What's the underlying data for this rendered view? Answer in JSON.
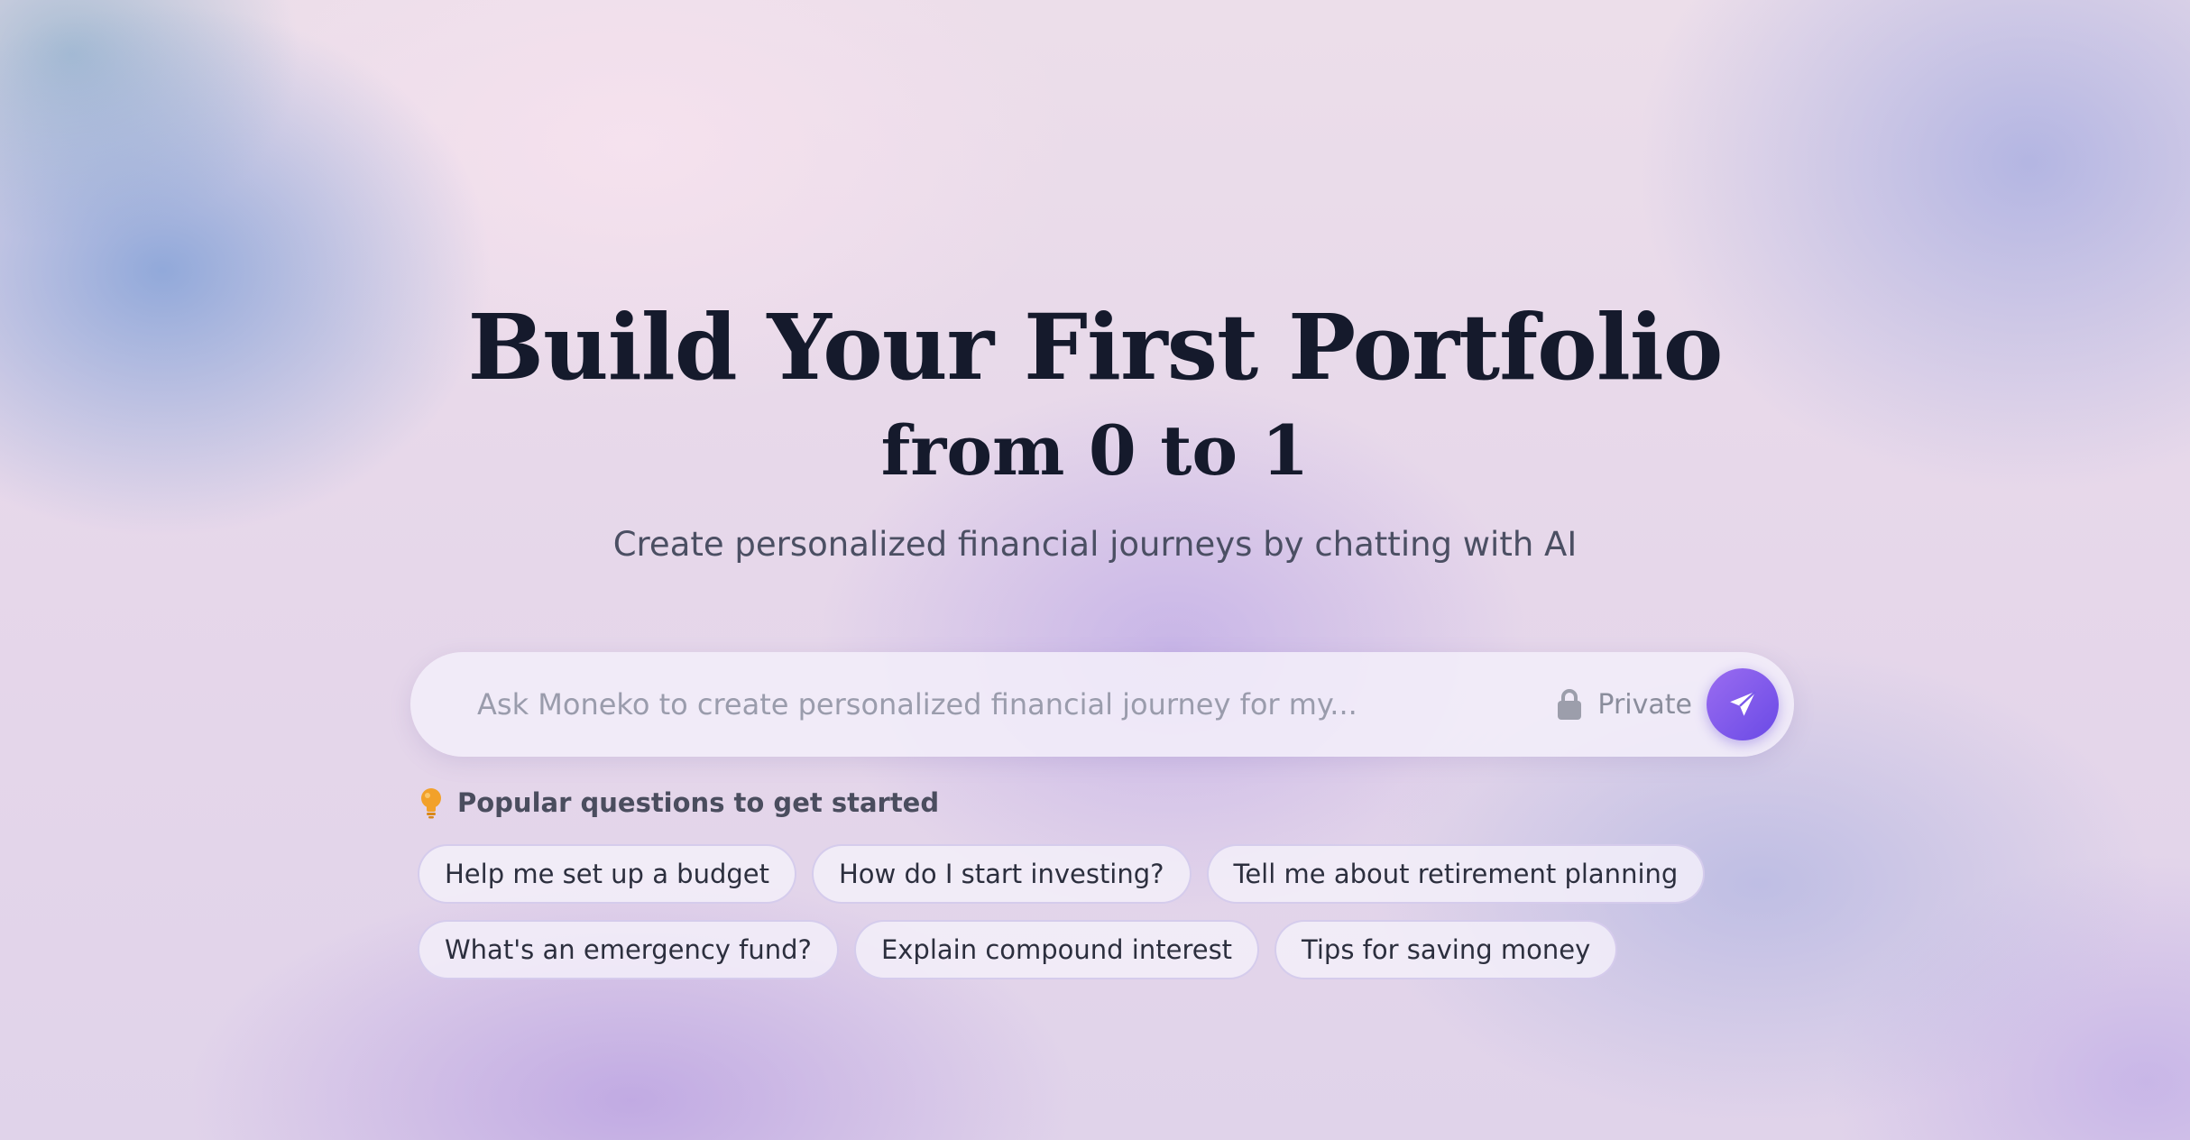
{
  "hero": {
    "title": "Build Your First Portfolio",
    "subtitle": "from 0 to 1",
    "tagline": "Create personalized financial journeys by chatting with AI"
  },
  "search": {
    "placeholder": "Ask Moneko to create personalized financial journey for my...",
    "value": "",
    "private_label": "Private",
    "lock_icon": "lock-icon",
    "send_icon": "send-icon"
  },
  "popular": {
    "icon": "lightbulb-icon",
    "heading": "Popular questions to get started",
    "rows": [
      [
        "Help me set up a budget",
        "How do I start investing?",
        "Tell me about retirement planning"
      ],
      [
        "What's an emergency fund?",
        "Explain compound interest",
        "Tips for saving money"
      ]
    ]
  },
  "colors": {
    "heading_text": "#151a2c",
    "tagline_text": "#4b4f63",
    "send_button_start": "#9a6cf0",
    "send_button_end": "#6a4ae6",
    "bulb": "#f0a020"
  }
}
